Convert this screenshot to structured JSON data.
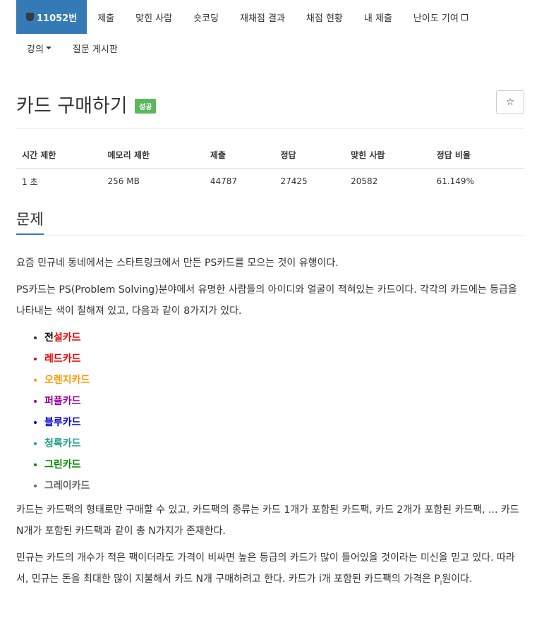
{
  "nav": {
    "problem_id": "11052번",
    "items": [
      "제출",
      "맞힌 사람",
      "숏코딩",
      "재채점 결과",
      "채점 현황",
      "내 제출",
      "난이도 기여"
    ],
    "row2": [
      "강의",
      "질문 게시판"
    ]
  },
  "problem": {
    "title": "카드 구매하기",
    "badge": "성공",
    "star": "☆"
  },
  "info_table": {
    "headers": [
      "시간 제한",
      "메모리 제한",
      "제출",
      "정답",
      "맞힌 사람",
      "정답 비율"
    ],
    "values": [
      "1 초",
      "256 MB",
      "44787",
      "27425",
      "20582",
      "61.149%"
    ]
  },
  "section": {
    "title": "문제"
  },
  "description": {
    "p1": "요즘 민규네 동네에서는 스타트링크에서 만든 PS카드를 모으는 것이 유행이다.",
    "p2": "PS카드는 PS(Problem Solving)분야에서 유명한 사람들의 아이디와 얼굴이 적혀있는 카드이다. 각각의 카드에는 등급을 나타내는 색이 칠해져 있고, 다음과 같이 8가지가 있다.",
    "cards": {
      "legend_a": "전",
      "legend_b": "설카드",
      "red": "레드카드",
      "orange": "오렌지카드",
      "purple": "퍼플카드",
      "blue": "블루카드",
      "teal": "청록카드",
      "green": "그린카드",
      "gray": "그레이카드"
    },
    "p3": "카드는 카드팩의 형태로만 구매할 수 있고, 카드팩의 종류는 카드 1개가 포함된 카드팩, 카드 2개가 포함된 카드팩, ... 카드 N개가 포함된 카드팩과 같이 총 N가지가 존재한다.",
    "p4_main": "민규는 카드의 개수가 적은 팩이더라도 가격이 비싸면 높은 등급의 카드가 많이 들어있을 것이라는 미신을 믿고 있다. 따라서, 민규는 돈을 최대한 많이 지불해서 카드 N개 구매하려고 한다. 카드가 i개 포함된 카드팩의 가격은 P",
    "p4_sub": "i",
    "p4_end": "원이다."
  },
  "colors": {
    "accent": "#337ab7",
    "success": "#5cb85c",
    "red": "#ee0000",
    "orange": "#ff9900",
    "purple": "#990099",
    "blue": "#0000cc",
    "teal": "#1a9f8a",
    "green": "#008800",
    "gray": "#666666"
  }
}
